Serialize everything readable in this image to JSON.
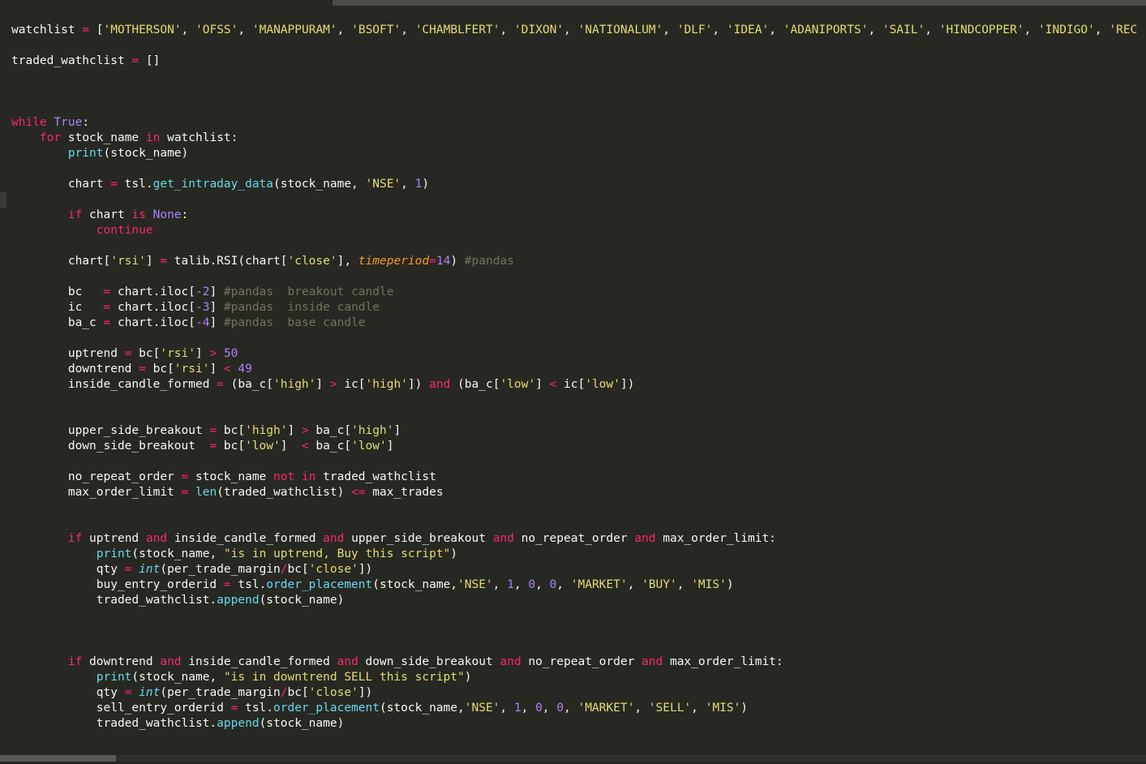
{
  "editor": {
    "theme": "monokai",
    "colors": {
      "background": "#272822",
      "text": "#f8f8f2",
      "keyword": "#f92672",
      "string": "#e6db74",
      "number": "#ae81ff",
      "comment": "#75715e",
      "function": "#66d9ef",
      "param": "#fd971f"
    }
  },
  "lines": [
    [
      [
        "watchlist ",
        ""
      ],
      [
        "=",
        "o"
      ],
      [
        " [",
        ""
      ],
      [
        "'MOTHERSON'",
        "s"
      ],
      [
        ", ",
        ""
      ],
      [
        "'OFSS'",
        "s"
      ],
      [
        ", ",
        ""
      ],
      [
        "'MANAPPURAM'",
        "s"
      ],
      [
        ", ",
        ""
      ],
      [
        "'BSOFT'",
        "s"
      ],
      [
        ", ",
        ""
      ],
      [
        "'CHAMBLFERT'",
        "s"
      ],
      [
        ", ",
        ""
      ],
      [
        "'DIXON'",
        "s"
      ],
      [
        ", ",
        ""
      ],
      [
        "'NATIONALUM'",
        "s"
      ],
      [
        ", ",
        ""
      ],
      [
        "'DLF'",
        "s"
      ],
      [
        ", ",
        ""
      ],
      [
        "'IDEA'",
        "s"
      ],
      [
        ", ",
        ""
      ],
      [
        "'ADANIPORTS'",
        "s"
      ],
      [
        ", ",
        ""
      ],
      [
        "'SAIL'",
        "s"
      ],
      [
        ", ",
        ""
      ],
      [
        "'HINDCOPPER'",
        "s"
      ],
      [
        ", ",
        ""
      ],
      [
        "'INDIGO'",
        "s"
      ],
      [
        ", ",
        ""
      ],
      [
        "'REC",
        "s"
      ]
    ],
    [],
    [
      [
        "traded_wathclist ",
        ""
      ],
      [
        "=",
        "o"
      ],
      [
        " []",
        ""
      ]
    ],
    [],
    [],
    [],
    [
      [
        "while",
        "k"
      ],
      [
        " ",
        ""
      ],
      [
        "True",
        "b"
      ],
      [
        ":",
        ""
      ]
    ],
    [
      [
        "    ",
        ""
      ],
      [
        "for",
        "k"
      ],
      [
        " stock_name ",
        ""
      ],
      [
        "in",
        "k"
      ],
      [
        " watchlist:",
        ""
      ]
    ],
    [
      [
        "        ",
        ""
      ],
      [
        "print",
        "f"
      ],
      [
        "(stock_name)",
        ""
      ]
    ],
    [],
    [
      [
        "        chart ",
        ""
      ],
      [
        "=",
        "o"
      ],
      [
        " tsl.",
        ""
      ],
      [
        "get_intraday_data",
        "f"
      ],
      [
        "(stock_name, ",
        ""
      ],
      [
        "'NSE'",
        "s"
      ],
      [
        ", ",
        ""
      ],
      [
        "1",
        "n"
      ],
      [
        ")",
        ""
      ]
    ],
    [],
    [
      [
        "        ",
        ""
      ],
      [
        "if",
        "k"
      ],
      [
        " chart ",
        ""
      ],
      [
        "is",
        "k"
      ],
      [
        " ",
        ""
      ],
      [
        "None",
        "b"
      ],
      [
        ":",
        ""
      ]
    ],
    [
      [
        "            ",
        ""
      ],
      [
        "continue",
        "k"
      ]
    ],
    [],
    [
      [
        "        chart[",
        ""
      ],
      [
        "'rsi'",
        "s"
      ],
      [
        "] ",
        ""
      ],
      [
        "=",
        "o"
      ],
      [
        " talib.RSI(chart[",
        ""
      ],
      [
        "'close'",
        "s"
      ],
      [
        "], ",
        ""
      ],
      [
        "timeperiod",
        "p"
      ],
      [
        "=",
        "o"
      ],
      [
        "14",
        "n"
      ],
      [
        ") ",
        ""
      ],
      [
        "#pandas",
        "c"
      ]
    ],
    [],
    [
      [
        "        bc   ",
        ""
      ],
      [
        "=",
        "o"
      ],
      [
        " chart.iloc[",
        ""
      ],
      [
        "-2",
        "n"
      ],
      [
        "] ",
        ""
      ],
      [
        "#pandas  breakout candle",
        "c"
      ]
    ],
    [
      [
        "        ic   ",
        ""
      ],
      [
        "=",
        "o"
      ],
      [
        " chart.iloc[",
        ""
      ],
      [
        "-3",
        "n"
      ],
      [
        "] ",
        ""
      ],
      [
        "#pandas  inside candle",
        "c"
      ]
    ],
    [
      [
        "        ba_c ",
        ""
      ],
      [
        "=",
        "o"
      ],
      [
        " chart.iloc[",
        ""
      ],
      [
        "-4",
        "n"
      ],
      [
        "] ",
        ""
      ],
      [
        "#pandas  base candle",
        "c"
      ]
    ],
    [],
    [
      [
        "        uptrend ",
        ""
      ],
      [
        "=",
        "o"
      ],
      [
        " bc[",
        ""
      ],
      [
        "'rsi'",
        "s"
      ],
      [
        "] ",
        ""
      ],
      [
        ">",
        "o"
      ],
      [
        " ",
        ""
      ],
      [
        "50",
        "n"
      ]
    ],
    [
      [
        "        downtrend ",
        ""
      ],
      [
        "=",
        "o"
      ],
      [
        " bc[",
        ""
      ],
      [
        "'rsi'",
        "s"
      ],
      [
        "] ",
        ""
      ],
      [
        "<",
        "o"
      ],
      [
        " ",
        ""
      ],
      [
        "49",
        "n"
      ]
    ],
    [
      [
        "        inside_candle_formed ",
        ""
      ],
      [
        "=",
        "o"
      ],
      [
        " (ba_c[",
        ""
      ],
      [
        "'high'",
        "s"
      ],
      [
        "] ",
        ""
      ],
      [
        ">",
        "o"
      ],
      [
        " ic[",
        ""
      ],
      [
        "'high'",
        "s"
      ],
      [
        "]) ",
        ""
      ],
      [
        "and",
        "k"
      ],
      [
        " (ba_c[",
        ""
      ],
      [
        "'low'",
        "s"
      ],
      [
        "] ",
        ""
      ],
      [
        "<",
        "o"
      ],
      [
        " ic[",
        ""
      ],
      [
        "'low'",
        "s"
      ],
      [
        "])",
        ""
      ]
    ],
    [],
    [],
    [
      [
        "        upper_side_breakout ",
        ""
      ],
      [
        "=",
        "o"
      ],
      [
        " bc[",
        ""
      ],
      [
        "'high'",
        "s"
      ],
      [
        "] ",
        ""
      ],
      [
        ">",
        "o"
      ],
      [
        " ba_c[",
        ""
      ],
      [
        "'high'",
        "s"
      ],
      [
        "]",
        ""
      ]
    ],
    [
      [
        "        down_side_breakout  ",
        ""
      ],
      [
        "=",
        "o"
      ],
      [
        " bc[",
        ""
      ],
      [
        "'low'",
        "s"
      ],
      [
        "]  ",
        ""
      ],
      [
        "<",
        "o"
      ],
      [
        " ba_c[",
        ""
      ],
      [
        "'low'",
        "s"
      ],
      [
        "]",
        ""
      ]
    ],
    [],
    [
      [
        "        no_repeat_order ",
        ""
      ],
      [
        "=",
        "o"
      ],
      [
        " stock_name ",
        ""
      ],
      [
        "not",
        "k"
      ],
      [
        " ",
        ""
      ],
      [
        "in",
        "k"
      ],
      [
        " traded_wathclist",
        ""
      ]
    ],
    [
      [
        "        max_order_limit ",
        ""
      ],
      [
        "=",
        "o"
      ],
      [
        " ",
        ""
      ],
      [
        "len",
        "f"
      ],
      [
        "(traded_wathclist) ",
        ""
      ],
      [
        "<=",
        "o"
      ],
      [
        " max_trades",
        ""
      ]
    ],
    [],
    [],
    [
      [
        "        ",
        ""
      ],
      [
        "if",
        "k"
      ],
      [
        " uptrend ",
        ""
      ],
      [
        "and",
        "k"
      ],
      [
        " inside_candle_formed ",
        ""
      ],
      [
        "and",
        "k"
      ],
      [
        " upper_side_breakout ",
        ""
      ],
      [
        "and",
        "k"
      ],
      [
        " no_repeat_order ",
        ""
      ],
      [
        "and",
        "k"
      ],
      [
        " max_order_limit:",
        ""
      ]
    ],
    [
      [
        "            ",
        ""
      ],
      [
        "print",
        "f"
      ],
      [
        "(stock_name, ",
        ""
      ],
      [
        "\"is in uptrend, Buy this script\"",
        "s"
      ],
      [
        ")",
        ""
      ]
    ],
    [
      [
        "            qty ",
        ""
      ],
      [
        "=",
        "o"
      ],
      [
        " ",
        ""
      ],
      [
        "int",
        "t"
      ],
      [
        "(per_trade_margin",
        ""
      ],
      [
        "/",
        "o"
      ],
      [
        "bc[",
        ""
      ],
      [
        "'close'",
        "s"
      ],
      [
        "])",
        ""
      ]
    ],
    [
      [
        "            buy_entry_orderid ",
        ""
      ],
      [
        "=",
        "o"
      ],
      [
        " tsl.",
        ""
      ],
      [
        "order_placement",
        "f"
      ],
      [
        "(stock_name,",
        ""
      ],
      [
        "'NSE'",
        "s"
      ],
      [
        ", ",
        ""
      ],
      [
        "1",
        "n"
      ],
      [
        ", ",
        ""
      ],
      [
        "0",
        "n"
      ],
      [
        ", ",
        ""
      ],
      [
        "0",
        "n"
      ],
      [
        ", ",
        ""
      ],
      [
        "'MARKET'",
        "s"
      ],
      [
        ", ",
        ""
      ],
      [
        "'BUY'",
        "s"
      ],
      [
        ", ",
        ""
      ],
      [
        "'MIS'",
        "s"
      ],
      [
        ")",
        ""
      ]
    ],
    [
      [
        "            traded_wathclist.",
        ""
      ],
      [
        "append",
        "f"
      ],
      [
        "(stock_name)",
        ""
      ]
    ],
    [],
    [],
    [],
    [
      [
        "        ",
        ""
      ],
      [
        "if",
        "k"
      ],
      [
        " downtrend ",
        ""
      ],
      [
        "and",
        "k"
      ],
      [
        " inside_candle_formed ",
        ""
      ],
      [
        "and",
        "k"
      ],
      [
        " down_side_breakout ",
        ""
      ],
      [
        "and",
        "k"
      ],
      [
        " no_repeat_order ",
        ""
      ],
      [
        "and",
        "k"
      ],
      [
        " max_order_limit:",
        ""
      ]
    ],
    [
      [
        "            ",
        ""
      ],
      [
        "print",
        "f"
      ],
      [
        "(stock_name, ",
        ""
      ],
      [
        "\"is in downtrend SELL this script\"",
        "s"
      ],
      [
        ")",
        ""
      ]
    ],
    [
      [
        "            qty ",
        ""
      ],
      [
        "=",
        "o"
      ],
      [
        " ",
        ""
      ],
      [
        "int",
        "t"
      ],
      [
        "(per_trade_margin",
        ""
      ],
      [
        "/",
        "o"
      ],
      [
        "bc[",
        ""
      ],
      [
        "'close'",
        "s"
      ],
      [
        "])",
        ""
      ]
    ],
    [
      [
        "            sell_entry_orderid ",
        ""
      ],
      [
        "=",
        "o"
      ],
      [
        " tsl.",
        ""
      ],
      [
        "order_placement",
        "f"
      ],
      [
        "(stock_name,",
        ""
      ],
      [
        "'NSE'",
        "s"
      ],
      [
        ", ",
        ""
      ],
      [
        "1",
        "n"
      ],
      [
        ", ",
        ""
      ],
      [
        "0",
        "n"
      ],
      [
        ", ",
        ""
      ],
      [
        "0",
        "n"
      ],
      [
        ", ",
        ""
      ],
      [
        "'MARKET'",
        "s"
      ],
      [
        ", ",
        ""
      ],
      [
        "'SELL'",
        "s"
      ],
      [
        ", ",
        ""
      ],
      [
        "'MIS'",
        "s"
      ],
      [
        ")",
        ""
      ]
    ],
    [
      [
        "            traded_wathclist.",
        ""
      ],
      [
        "append",
        "f"
      ],
      [
        "(stock_name)",
        ""
      ]
    ]
  ]
}
